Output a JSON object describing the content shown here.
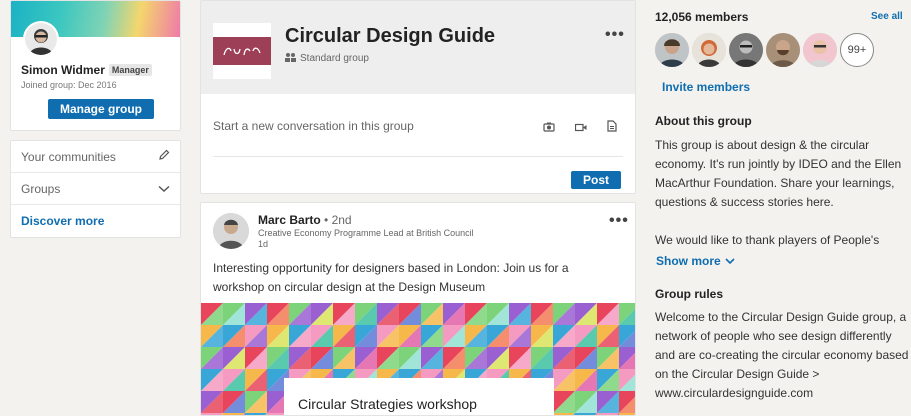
{
  "profile": {
    "name": "Simon Widmer",
    "badge": "Manager",
    "joined": "Joined group: Dec 2016",
    "manage_label": "Manage group"
  },
  "communities": {
    "your_communities": "Your communities",
    "groups": "Groups",
    "discover_more": "Discover more"
  },
  "group": {
    "title": "Circular Design Guide",
    "type": "Standard group",
    "logo_accent": "#9d3f56",
    "compose_placeholder": "Start a new conversation in this group",
    "post_label": "Post"
  },
  "post": {
    "author": "Marc Barto",
    "degree": "• 2nd",
    "headline": "Creative Economy Programme Lead at British Council",
    "time": "1d",
    "text": "Interesting opportunity for designers based in London: Join us for a workshop on circular design at the Design Museum",
    "image_caption": "Circular Strategies workshop"
  },
  "sidebar": {
    "members_count": "12,056 members",
    "see_all": "See all",
    "more_members": "99+",
    "invite": "Invite members",
    "about_title": "About this group",
    "about_text": "This group is about design & the circular economy. It's run jointly by IDEO and the Ellen MacArthur Foundation. Share your learnings, questions & success stories here.",
    "thanks_text": "We would like to thank players of People's",
    "show_more": "Show more",
    "rules_title": "Group rules",
    "rules_text": "Welcome to the Circular Design Guide group, a network of people who see design differently and are co-creating the circular economy based on the Circular Design Guide >  www.circulardesignguide.com"
  },
  "colors": {
    "accent": "#0f6db0",
    "background": "#f3f2ef"
  }
}
